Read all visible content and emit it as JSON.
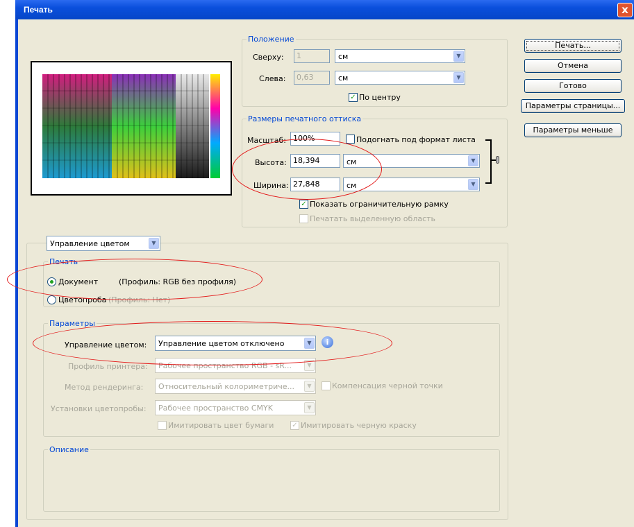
{
  "window": {
    "title": "Печать",
    "close": "x"
  },
  "position": {
    "legend": "Положение",
    "top_label": "Сверху:",
    "top_value": "1",
    "top_unit": "см",
    "left_label": "Слева:",
    "left_value": "0,63",
    "left_unit": "см",
    "center_label": "По центру",
    "center_checked": true
  },
  "size": {
    "legend": "Размеры печатного оттиска",
    "scale_label": "Масштаб:",
    "scale_value": "100%",
    "fit_label": "Подогнать под формат листа",
    "height_label": "Высота:",
    "height_value": "18,394",
    "height_unit": "см",
    "width_label": "Ширина:",
    "width_value": "27,848",
    "width_unit": "см",
    "bounding_label": "Показать ограничительную рамку",
    "bounding_checked": true,
    "print_selection_label": "Печатать выделенную область"
  },
  "buttons": {
    "print": "Печать...",
    "cancel": "Отмена",
    "done": "Готово",
    "page_setup": "Параметры страницы...",
    "fewer_options": "Параметры меньше"
  },
  "section_select": "Управление цветом",
  "print_group": {
    "legend": "Печать",
    "document_label": "Документ",
    "document_profile": "(Профиль: RGB без профиля)",
    "proof_label": "Цветопроба",
    "proof_profile": "(Профиль: Нет)"
  },
  "options": {
    "legend": "Параметры",
    "color_handling_label": "Управление цветом:",
    "color_handling_value": "Управление цветом отключено",
    "printer_profile_label": "Профиль принтера:",
    "printer_profile_value": "Рабочее пространство RGB - sR...",
    "rendering_label": "Метод рендеринга:",
    "rendering_value": "Относительный колориметриче...",
    "bpc_label": "Компенсация черной точки",
    "proof_setup_label": "Установки цветопробы:",
    "proof_setup_value": "Рабочее пространство CMYK",
    "simulate_paper_label": "Имитировать цвет бумаги",
    "simulate_ink_label": "Имитировать черную краску"
  },
  "description": {
    "legend": "Описание"
  }
}
